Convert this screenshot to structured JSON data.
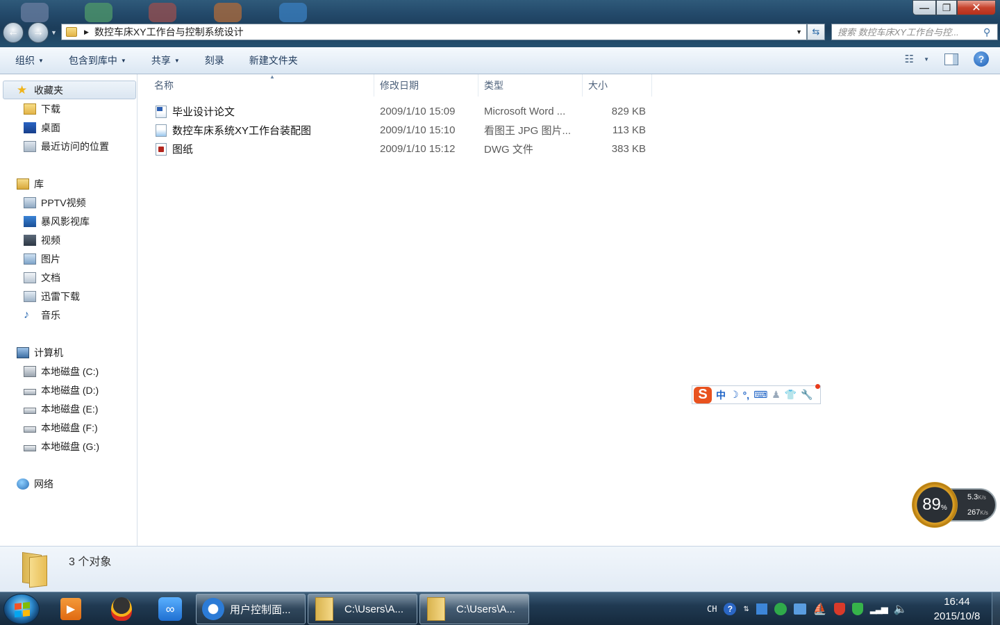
{
  "window": {
    "minimize": "—",
    "maximize": "❐",
    "close": "✕"
  },
  "address": {
    "path": "数控车床XY工作台与控制系统设计",
    "search_placeholder": "搜索 数控车床XY工作台与控..."
  },
  "toolbar": {
    "organize": "组织",
    "include_library": "包含到库中",
    "share": "共享",
    "burn": "刻录",
    "new_folder": "新建文件夹",
    "help": "?"
  },
  "nav": {
    "favorites": "收藏夹",
    "favorites_items": [
      "下载",
      "桌面",
      "最近访问的位置"
    ],
    "libraries": "库",
    "library_items": [
      "PPTV视频",
      "暴风影视库",
      "视频",
      "图片",
      "文档",
      "迅雷下载",
      "音乐"
    ],
    "computer": "计算机",
    "drives": [
      "本地磁盘 (C:)",
      "本地磁盘 (D:)",
      "本地磁盘 (E:)",
      "本地磁盘 (F:)",
      "本地磁盘 (G:)"
    ],
    "network": "网络"
  },
  "columns": {
    "name": "名称",
    "date": "修改日期",
    "type": "类型",
    "size": "大小"
  },
  "files": [
    {
      "name": "毕业设计论文",
      "date": "2009/1/10 15:09",
      "type": "Microsoft Word ...",
      "size": "829 KB",
      "icon": "word-doc-icon"
    },
    {
      "name": "数控车床系统XY工作台装配图",
      "date": "2009/1/10 15:10",
      "type": "看图王 JPG 图片...",
      "size": "113 KB",
      "icon": "jpg-image-icon"
    },
    {
      "name": "图纸",
      "date": "2009/1/10 15:12",
      "type": "DWG 文件",
      "size": "383 KB",
      "icon": "dwg-file-icon"
    }
  ],
  "ime": {
    "logo": "S",
    "mode": "中"
  },
  "speed_widget": {
    "percent": "89",
    "percent_unit": "%",
    "upload": "5.3",
    "download": "267",
    "unit": "K/s"
  },
  "status": {
    "count": "3 个对象"
  },
  "taskbar": {
    "tasks": [
      "用户控制面...",
      "C:\\Users\\A...",
      "C:\\Users\\A..."
    ],
    "lang": "CH",
    "time": "16:44",
    "date": "2015/10/8"
  },
  "colors": {
    "ime_logo": "#e8521f",
    "accent_blue": "#1e63c6",
    "taskbar": "#203a52"
  }
}
